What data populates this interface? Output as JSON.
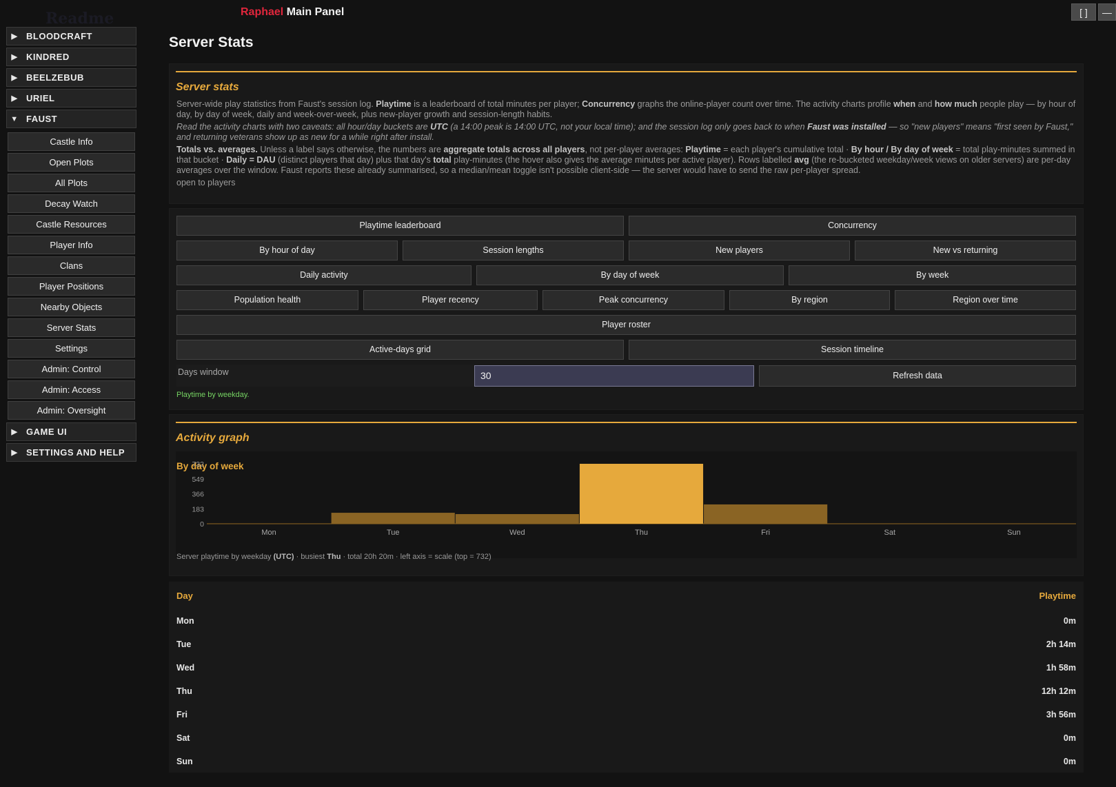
{
  "titlebar": {
    "ghost_text": "Readme",
    "brand": "Raphael",
    "title": "Main Panel",
    "maximize_label": "[ ]",
    "minimize_label": "—"
  },
  "sidebar": {
    "categories_top": [
      {
        "label": "BLOODCRAFT",
        "expanded": false
      },
      {
        "label": "KINDRED",
        "expanded": false
      },
      {
        "label": "BEELZEBUB",
        "expanded": false
      },
      {
        "label": "URIEL",
        "expanded": false
      },
      {
        "label": "FAUST",
        "expanded": true
      }
    ],
    "faust_items": [
      "Castle Info",
      "Open Plots",
      "All Plots",
      "Decay Watch",
      "Castle Resources",
      "Player Info",
      "Clans",
      "Player Positions",
      "Nearby Objects",
      "Server Stats",
      "Settings",
      "Admin: Control",
      "Admin: Access",
      "Admin: Oversight"
    ],
    "categories_bottom": [
      {
        "label": "GAME UI",
        "expanded": false
      },
      {
        "label": "SETTINGS AND HELP",
        "expanded": false
      }
    ]
  },
  "page": {
    "title": "Server Stats"
  },
  "intro": {
    "heading": "Server stats",
    "p1_a": "Server-wide play statistics from Faust's session log. ",
    "p1_b": "Playtime",
    "p1_c": " is a leaderboard of total minutes per player; ",
    "p1_d": "Concurrency",
    "p1_e": " graphs the online-player count over time. The activity charts profile ",
    "p1_f": "when",
    "p1_g": " and ",
    "p1_h": "how much",
    "p1_i": " people play — by hour of day, by day of week, daily and week-over-week, plus new-player growth and session-length habits.",
    "p2_a": "Read the activity charts with two caveats: all hour/day buckets are ",
    "p2_b": "UTC",
    "p2_c": " (a 14:00 peak is 14:00 UTC, not your local time); and the session log only goes back to when ",
    "p2_d": "Faust was installed",
    "p2_e": " — so \"new players\" means \"first seen by Faust,\" and returning veterans show up as new for a while right after install.",
    "p3_a": "Totals vs. averages.",
    "p3_b": " Unless a label says otherwise, the numbers are ",
    "p3_c": "aggregate totals across all players",
    "p3_d": ", not per-player averages: ",
    "p3_e": "Playtime",
    "p3_f": " = each player's cumulative total · ",
    "p3_g": "By hour / By day of week",
    "p3_h": " = total play-minutes summed in that bucket · ",
    "p3_i": "Daily = DAU",
    "p3_j": " (distinct players that day) plus that day's ",
    "p3_k": "total",
    "p3_l": " play-minutes (the hover also gives the average minutes per active player). Rows labelled ",
    "p3_m": "avg",
    "p3_n": " (the re-bucketed weekday/week views on older servers) are per-day averages over the window. Faust reports these already summarised, so a median/mean toggle isn't possible client-side — the server would have to send the raw per-player spread.",
    "access": "open to players"
  },
  "buttons": {
    "row1": [
      "Playtime leaderboard",
      "Concurrency"
    ],
    "row2": [
      "By hour of day",
      "Session lengths",
      "New players",
      "New vs returning"
    ],
    "row3": [
      "Daily activity",
      "By day of week",
      "By week"
    ],
    "row4": [
      "Population health",
      "Player recency",
      "Peak concurrency",
      "By region",
      "Region over time"
    ],
    "row5": [
      "Player roster"
    ],
    "row6": [
      "Active-days grid",
      "Session timeline"
    ]
  },
  "controls": {
    "days_label": "Days window",
    "days_value": "30",
    "refresh_label": "Refresh data",
    "status": "Playtime by weekday."
  },
  "activity": {
    "heading": "Activity graph",
    "caption_a": "Server playtime by weekday ",
    "caption_b": "(UTC)",
    "caption_c": " · busiest ",
    "caption_d": "Thu",
    "caption_e": " · total 20h 20m · left axis = scale (top = 732)"
  },
  "colors": {
    "accent": "#e6a93c",
    "bar_dim": "#8a6424",
    "brand_red": "#e0263c",
    "status_green": "#76d463"
  },
  "chart_data": {
    "type": "bar",
    "title": "By day of week",
    "categories": [
      "Mon",
      "Tue",
      "Wed",
      "Thu",
      "Fri",
      "Sat",
      "Sun"
    ],
    "values": [
      0,
      134,
      118,
      732,
      236,
      0,
      0
    ],
    "y_ticks": [
      0,
      183,
      366,
      549,
      732
    ],
    "ylim": [
      0,
      732
    ],
    "highlight": "Thu",
    "grid": false
  },
  "table": {
    "headers": [
      "Day",
      "Playtime"
    ],
    "rows": [
      [
        "Mon",
        "0m"
      ],
      [
        "Tue",
        "2h 14m"
      ],
      [
        "Wed",
        "1h 58m"
      ],
      [
        "Thu",
        "12h 12m"
      ],
      [
        "Fri",
        "3h 56m"
      ],
      [
        "Sat",
        "0m"
      ],
      [
        "Sun",
        "0m"
      ]
    ]
  }
}
